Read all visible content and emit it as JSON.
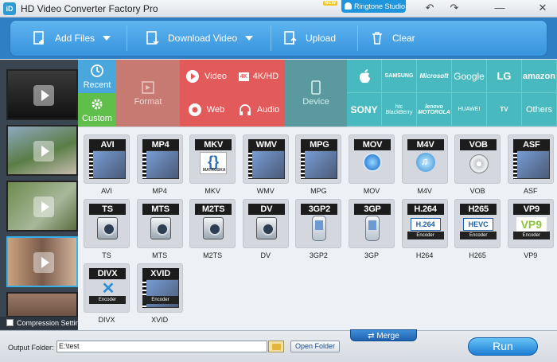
{
  "app": {
    "title": "HD Video Converter Factory Pro",
    "logo_text": "iD",
    "new_badge": "NEW",
    "ringtone_studio": "Ringtone Studio"
  },
  "window_controls": [
    "↶",
    "↷",
    "—",
    "✕"
  ],
  "toolbar": {
    "add_files": "Add Files",
    "download_video": "Download Video",
    "upload": "Upload",
    "clear": "Clear"
  },
  "categories": {
    "recent": "Recent",
    "custom": "Custom",
    "format": "Format",
    "video": "Video",
    "fourk_badge": "4K",
    "fourk": "4K/HD",
    "web": "Web",
    "audio": "Audio",
    "device": "Device"
  },
  "devices": [
    "Apple",
    "SAMSUNG",
    "Microsoft",
    "Google",
    "LG",
    "amazon",
    "SONY",
    "htc BlackBerry",
    "lenovo MOTOROLA",
    "HUAWEI",
    "TV",
    "Others"
  ],
  "formats": [
    {
      "badge": "AVI",
      "label": "AVI",
      "art": "film"
    },
    {
      "badge": "MP4",
      "label": "MP4",
      "art": "film"
    },
    {
      "badge": "MKV",
      "label": "MKV",
      "art": "matroska"
    },
    {
      "badge": "WMV",
      "label": "WMV",
      "art": "film"
    },
    {
      "badge": "MPG",
      "label": "MPG",
      "art": "film"
    },
    {
      "badge": "MOV",
      "label": "MOV",
      "art": "quicktime"
    },
    {
      "badge": "M4V",
      "label": "M4V",
      "art": "itunes"
    },
    {
      "badge": "VOB",
      "label": "VOB",
      "art": "dvd"
    },
    {
      "badge": "ASF",
      "label": "ASF",
      "art": "film"
    },
    {
      "badge": "TS",
      "label": "TS",
      "art": "camera"
    },
    {
      "badge": "MTS",
      "label": "MTS",
      "art": "camera"
    },
    {
      "badge": "M2TS",
      "label": "M2TS",
      "art": "camera"
    },
    {
      "badge": "DV",
      "label": "DV",
      "art": "camera"
    },
    {
      "badge": "3GP2",
      "label": "3GP2",
      "art": "phone"
    },
    {
      "badge": "3GP",
      "label": "3GP",
      "art": "phone"
    },
    {
      "badge": "H.264",
      "label": "H264",
      "art": "h264",
      "inner": "H.264",
      "encoder": "Encoder"
    },
    {
      "badge": "H265",
      "label": "H265",
      "art": "hevc",
      "inner": "HEVC",
      "encoder": "Encoder"
    },
    {
      "badge": "VP9",
      "label": "VP9",
      "art": "vp9",
      "inner": "VP9",
      "encoder": "Encoder"
    },
    {
      "badge": "DIVX",
      "label": "DIVX",
      "art": "divx",
      "inner": "✕",
      "encoder": "Encoder"
    },
    {
      "badge": "XVID",
      "label": "XVID",
      "art": "film",
      "encoder": "Encoder"
    }
  ],
  "matroska_text": "MATROSKA",
  "compression": "Compression Settings",
  "bottom": {
    "merge": "Merge",
    "output_folder_label": "Output Folder:",
    "output_path": "E:\\test",
    "open_folder": "Open Folder",
    "run": "Run"
  }
}
